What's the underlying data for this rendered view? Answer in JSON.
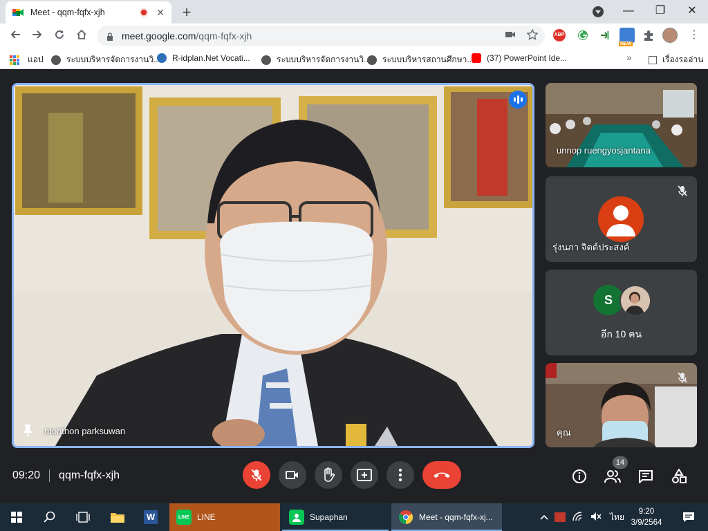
{
  "browser": {
    "tab_title": "Meet - qqm-fqfx-xjh",
    "new_tab_symbol": "+",
    "url_host": "meet.google.com",
    "url_path": "/qqm-fqfx-xjh",
    "ext_abp_label": "ABP",
    "ext_new_label": "NEW",
    "window_controls": {
      "minimize": "—",
      "restore": "❐",
      "close": "✕"
    }
  },
  "bookmarks": {
    "apps_label": "แอป",
    "items": [
      "ระบบบริหารจัดการงานวิ...",
      "R-idplan.Net Vocati...",
      "ระบบบริหารจัดการงานวิ...",
      "ระบบบริหารสถานศึกษา...",
      "(37) PowerPoint Ide..."
    ],
    "more_symbol": "»",
    "reading_list": "เรื่องรออ่าน"
  },
  "meeting": {
    "time": "09:20",
    "code": "qqm-fqfx-xjh",
    "participants_count": "14",
    "main_speaker": "monthon parksuwan",
    "tiles": {
      "tile1_name": "unnop ruengyosjantana",
      "tile2_name": "รุ่งนภา จิตต์ประสงค์",
      "tile3_avatar_letter": "S",
      "tile3_more": "อีก 10 คน",
      "tile4_name": "คุณ"
    }
  },
  "taskbar": {
    "apps": [
      "LINE",
      "Supaphan",
      "Meet - qqm-fqfx-xj..."
    ],
    "line_icon_text": "LINE",
    "word_icon_text": "W",
    "language": "ไทย",
    "time": "9:20",
    "date": "3/9/2564"
  },
  "colors": {
    "accent_blue": "#8ab4f8",
    "hangup_red": "#ea4335",
    "meet_bg": "#202124",
    "tile_bg": "#3c4043",
    "taskbar": "#1c2b38"
  }
}
